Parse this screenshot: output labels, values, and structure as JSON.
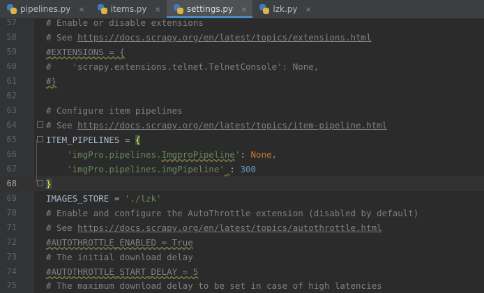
{
  "tabs": [
    {
      "label": "pipelines.py",
      "active": false
    },
    {
      "label": "items.py",
      "active": false
    },
    {
      "label": "settings.py",
      "active": true
    },
    {
      "label": "lzk.py",
      "active": false
    }
  ],
  "close_glyph": "×",
  "current_line": "68",
  "lines": [
    {
      "num": "57",
      "t1": "# Enable or disable extensions"
    },
    {
      "num": "58",
      "t1": "# See ",
      "t2": "https://docs.scrapy.org/en/latest/topics/extensions.html"
    },
    {
      "num": "59",
      "t1": "#EXTENSIONS = {"
    },
    {
      "num": "60",
      "t1": "#    'scrapy.extensions.telnet.TelnetConsole': None,"
    },
    {
      "num": "61",
      "t1": "#}"
    },
    {
      "num": "62"
    },
    {
      "num": "63",
      "t1": "# Configure item pipelines"
    },
    {
      "num": "64",
      "t1": "# See ",
      "t2": "https://docs.scrapy.org/en/latest/topics/item-pipeline.html"
    },
    {
      "num": "65",
      "t1": "ITEM_PIPELINES = ",
      "t2": "{"
    },
    {
      "num": "66",
      "t1": "    ",
      "t2": "'imgPro.pipelines.",
      "t3": "ImgproPipeline",
      "t4": "'",
      "t5": ": ",
      "t6": "None",
      "t7": ","
    },
    {
      "num": "67",
      "t1": "    ",
      "t2": "'imgPro.pipelines.imgPipeline'",
      "t3": " ",
      "t4": ": ",
      "t5": "300"
    },
    {
      "num": "68",
      "t1": "}"
    },
    {
      "num": "69",
      "t1": "IMAGES_STORE = ",
      "t2": "'./lzk'"
    },
    {
      "num": "70",
      "t1": "# Enable and configure the AutoThrottle extension (disabled by default)"
    },
    {
      "num": "71",
      "t1": "# See ",
      "t2": "https://docs.scrapy.org/en/latest/topics/autothrottle.html"
    },
    {
      "num": "72",
      "t1": "#AUTOTHROTTLE_ENABLED = True"
    },
    {
      "num": "73",
      "t1": "# The initial download delay"
    },
    {
      "num": "74",
      "t1": "#AUTOTHROTTLE_START_DELAY = 5"
    },
    {
      "num": "75",
      "t1": "# The maximum download delay to be set in case of high latencies"
    }
  ]
}
